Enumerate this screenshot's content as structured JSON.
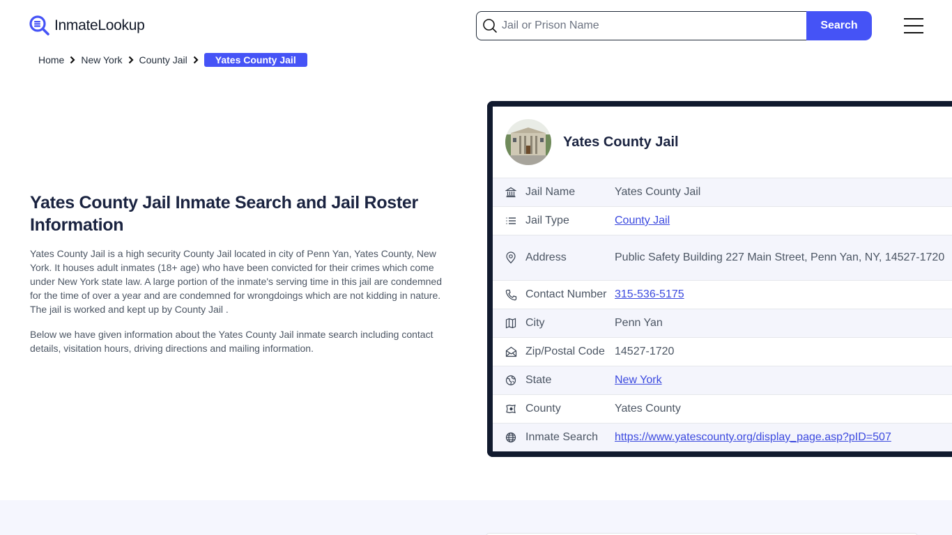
{
  "header": {
    "logo_text": "InmateLookup",
    "search": {
      "placeholder": "Jail or Prison Name",
      "value": "",
      "button_label": "Search"
    },
    "menu_icon": "hamburger-icon"
  },
  "breadcrumb": {
    "items": [
      {
        "label": "Home"
      },
      {
        "label": "New York"
      },
      {
        "label": "County Jail"
      }
    ],
    "current": "Yates County Jail"
  },
  "main": {
    "title": "Yates County Jail Inmate Search and Jail Roster Information",
    "paragraphs": [
      "Yates County Jail is a high security County Jail located in city of Penn Yan, Yates County, New York. It houses adult inmates (18+ age) who have been convicted for their crimes which come under New York state law. A large portion of the inmate's serving time in this jail are condemned for the time of over a year and are condemned for wrongdoings which are not kidding in nature. The jail is worked and kept up by County Jail .",
      "Below we have given information about the Yates County Jail inmate search including contact details, visitation hours, driving directions and mailing information."
    ]
  },
  "card": {
    "name": "Yates County Jail",
    "rows": [
      {
        "icon": "building-icon",
        "label": "Jail Name",
        "value": "Yates County Jail",
        "link": false
      },
      {
        "icon": "list-icon",
        "label": "Jail Type",
        "value": "County Jail",
        "link": true
      },
      {
        "icon": "map-pin-icon",
        "label": "Address",
        "value": "Public Safety Building 227 Main Street, Penn Yan, NY, 14527-1720",
        "link": false
      },
      {
        "icon": "phone-icon",
        "label": "Contact Number",
        "value": "315-536-5175",
        "link": true
      },
      {
        "icon": "map-icon",
        "label": "City",
        "value": "Penn Yan",
        "link": false
      },
      {
        "icon": "mail-open-icon",
        "label": "Zip/Postal Code",
        "value": "14527-1720",
        "link": false
      },
      {
        "icon": "globe-region-icon",
        "label": "State",
        "value": "New York",
        "link": true
      },
      {
        "icon": "county-map-icon",
        "label": "County",
        "value": "Yates County",
        "link": false
      },
      {
        "icon": "globe-icon",
        "label": "Inmate Search",
        "value": "https://www.yatescounty.org/display_page.asp?pID=507",
        "link": true
      }
    ]
  },
  "colors": {
    "accent": "#4553f6",
    "card_border": "#111a2e",
    "link": "#3b49df",
    "row_alt": "#f4f5fc",
    "heading": "#1a2340"
  }
}
